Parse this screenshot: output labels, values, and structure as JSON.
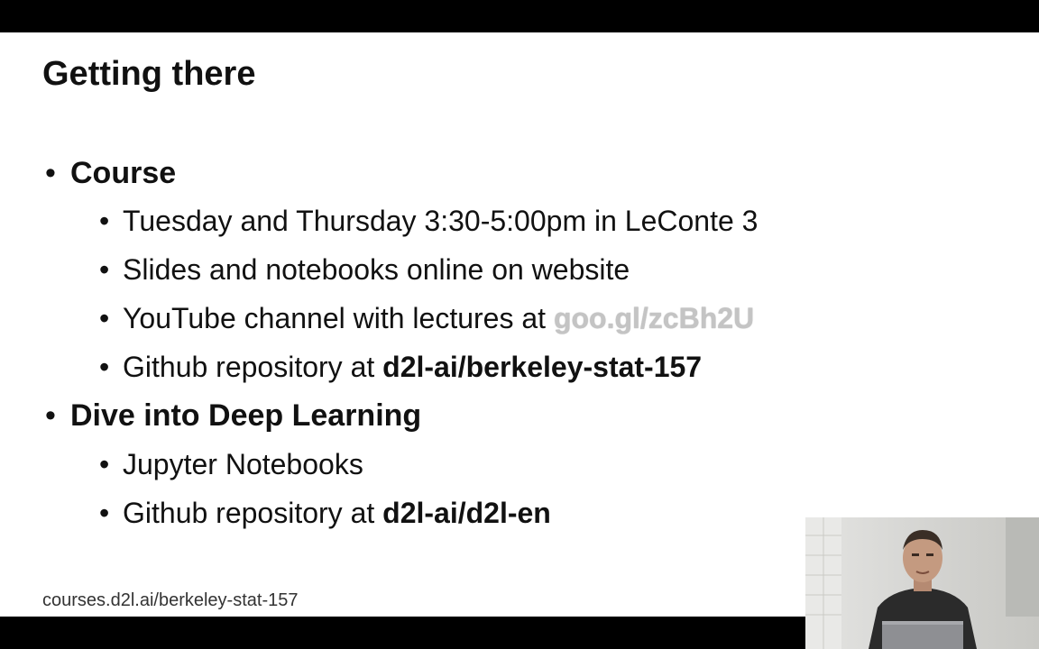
{
  "slide": {
    "title": "Getting there",
    "bullet_glyph": "•",
    "sections": [
      {
        "heading": "Course",
        "items": [
          {
            "text": "Tuesday and Thursday 3:30-5:00pm in LeConte 3"
          },
          {
            "text": "Slides and notebooks online on website"
          },
          {
            "prefix": "YouTube channel with lectures at ",
            "link": "goo.gl/zcBh2U"
          },
          {
            "prefix": "Github repository at ",
            "emph": "d2l-ai/berkeley-stat-157"
          }
        ]
      },
      {
        "heading": "Dive into Deep Learning",
        "items": [
          {
            "text": "Jupyter Notebooks"
          },
          {
            "prefix": "Github repository at ",
            "emph": "d2l-ai/d2l-en"
          }
        ]
      }
    ],
    "footer_url": "courses.d2l.ai/berkeley-stat-157"
  },
  "colors": {
    "letterbox": "#000000",
    "slide_background": "#ffffff",
    "text": "#111111",
    "link_gray": "#c4c4c4"
  },
  "webcam": {
    "icon": "presenter-webcam-feed"
  }
}
